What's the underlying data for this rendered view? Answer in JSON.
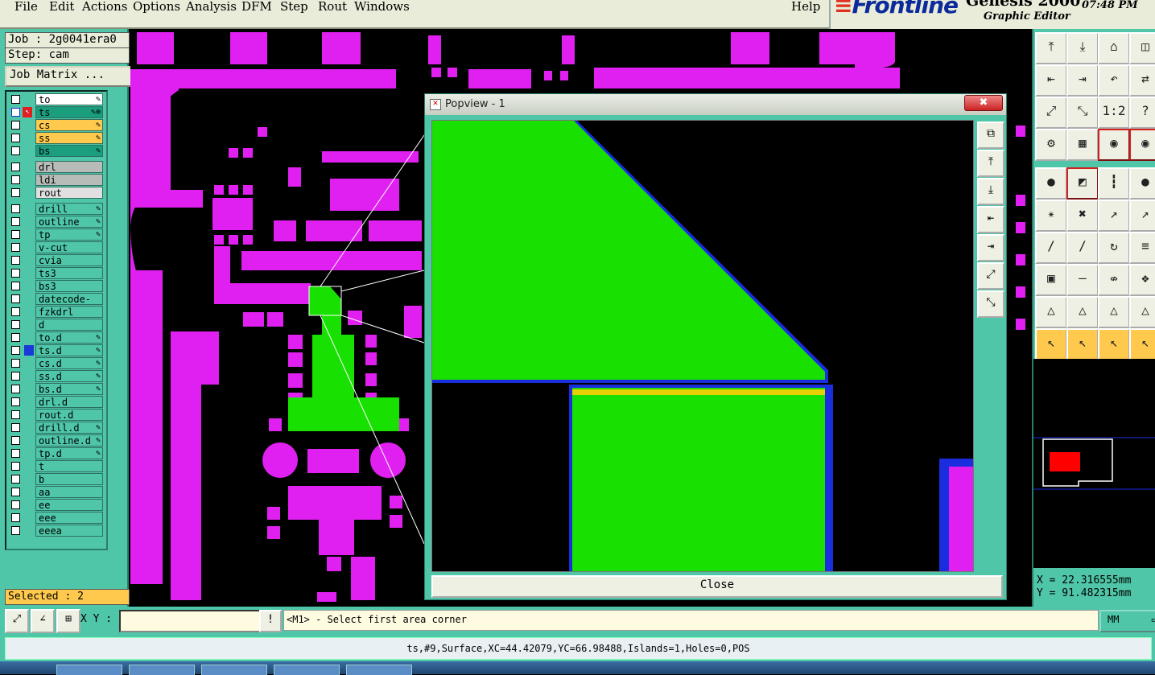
{
  "menu": {
    "items": [
      {
        "label": "File"
      },
      {
        "label": "Edit"
      },
      {
        "label": "Actions"
      },
      {
        "label": "Options"
      },
      {
        "label": "Analysis"
      },
      {
        "label": "DFM"
      },
      {
        "label": "Step"
      },
      {
        "label": "Rout"
      },
      {
        "label": "Windows"
      }
    ],
    "help": "Help"
  },
  "brand": {
    "logo_bars": "≡",
    "logo": "Frontline",
    "product": "Genesis 2000",
    "subtitle": "Graphic Editor",
    "time": "07:48 PM"
  },
  "job": {
    "job_label": "Job : 2g0041era0",
    "step_label": "Step: cam",
    "matrix_button": "Job Matrix ...",
    "selected": "Selected : 2"
  },
  "layers": [
    {
      "name": "to",
      "bg": "#ffffff",
      "mark": "✎"
    },
    {
      "name": "ts",
      "bg": "#1a9e7e",
      "mark": "✎⊕",
      "active": true
    },
    {
      "name": "cs",
      "bg": "#ffc94d",
      "mark": "✎"
    },
    {
      "name": "ss",
      "bg": "#ffc94d",
      "mark": "✎"
    },
    {
      "name": "bs",
      "bg": "#1a9e7e",
      "mark": "✎"
    },
    {
      "name": "drl",
      "bg": "#b8bcb8",
      "mark": ""
    },
    {
      "name": "ldi",
      "bg": "#b8bcb8",
      "mark": ""
    },
    {
      "name": "rout",
      "bg": "#e0e0e0",
      "mark": ""
    },
    {
      "name": "drill",
      "bg": "#4fc6a8",
      "mark": "✎"
    },
    {
      "name": "outline",
      "bg": "#4fc6a8",
      "mark": "✎"
    },
    {
      "name": "tp",
      "bg": "#4fc6a8",
      "mark": "✎"
    },
    {
      "name": "v-cut",
      "bg": "#4fc6a8",
      "mark": ""
    },
    {
      "name": "cvia",
      "bg": "#4fc6a8",
      "mark": ""
    },
    {
      "name": "ts3",
      "bg": "#4fc6a8",
      "mark": ""
    },
    {
      "name": "bs3",
      "bg": "#4fc6a8",
      "mark": ""
    },
    {
      "name": "datecode-to",
      "bg": "#4fc6a8",
      "mark": ""
    },
    {
      "name": "fzkdrl",
      "bg": "#4fc6a8",
      "mark": ""
    },
    {
      "name": "d",
      "bg": "#4fc6a8",
      "mark": ""
    },
    {
      "name": "to.d",
      "bg": "#4fc6a8",
      "mark": "✎"
    },
    {
      "name": "ts.d",
      "bg": "#4fc6a8",
      "mark": "✎",
      "color": "#1a3ad8"
    },
    {
      "name": "cs.d",
      "bg": "#4fc6a8",
      "mark": "✎"
    },
    {
      "name": "ss.d",
      "bg": "#4fc6a8",
      "mark": "✎"
    },
    {
      "name": "bs.d",
      "bg": "#4fc6a8",
      "mark": "✎"
    },
    {
      "name": "drl.d",
      "bg": "#4fc6a8",
      "mark": ""
    },
    {
      "name": "rout.d",
      "bg": "#4fc6a8",
      "mark": ""
    },
    {
      "name": "drill.d",
      "bg": "#4fc6a8",
      "mark": "✎"
    },
    {
      "name": "outline.d",
      "bg": "#4fc6a8",
      "mark": "✎"
    },
    {
      "name": "tp.d",
      "bg": "#4fc6a8",
      "mark": "✎"
    },
    {
      "name": "t",
      "bg": "#4fc6a8",
      "mark": ""
    },
    {
      "name": "b",
      "bg": "#4fc6a8",
      "mark": ""
    },
    {
      "name": "aa",
      "bg": "#4fc6a8",
      "mark": ""
    },
    {
      "name": "ee",
      "bg": "#4fc6a8",
      "mark": ""
    },
    {
      "name": "eee",
      "bg": "#4fc6a8",
      "mark": ""
    },
    {
      "name": "eeea",
      "bg": "#4fc6a8",
      "mark": ""
    }
  ],
  "popview": {
    "title": "Popview - 1",
    "close_x": "✖",
    "close_button": "Close",
    "tools": [
      "⧉",
      "⤒",
      "⤓",
      "⇤",
      "⇥",
      "⤢",
      "⤡"
    ]
  },
  "toolbar": {
    "icons": [
      "⤒",
      "⤓",
      "⌂",
      "◫",
      "⇤",
      "⇥",
      "↶",
      "⇄",
      "⤢",
      "⤡",
      "1:2",
      "?",
      "⚙",
      "▦",
      "◉",
      "◉",
      "●",
      "◩",
      "┇",
      "●",
      "✴",
      "✖",
      "↗",
      "↗",
      "∕",
      "∕",
      "↻",
      "≡",
      "▣",
      "—",
      "⇎",
      "❖",
      "△",
      "△",
      "△",
      "△",
      "↖",
      "↖",
      "↖",
      "↖"
    ]
  },
  "coords": {
    "x": "X = 22.316555mm",
    "y": "Y = 91.482315mm"
  },
  "bottom": {
    "icons": [
      "⤢",
      "∠",
      "⊞"
    ],
    "xy_label": "X Y :",
    "xy_value": "",
    "bang": "!",
    "prompt": "<M1> - Select first area corner",
    "units": "MM"
  },
  "status": {
    "text": "ts,#9,Surface,XC=44.42079,YC=66.98488,Islands=1,Holes=0,POS"
  },
  "colors": {
    "magenta": "#e020f0",
    "green": "#18e000",
    "blue": "#1a2ee0",
    "yellow": "#e8d000",
    "panel": "#4fc6a8"
  }
}
